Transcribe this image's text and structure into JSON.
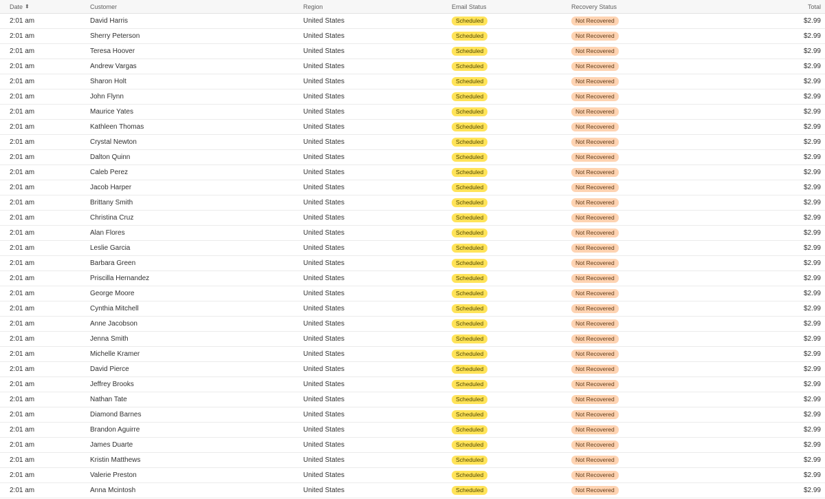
{
  "columns": {
    "date": "Date",
    "customer": "Customer",
    "region": "Region",
    "email_status": "Email Status",
    "recovery_status": "Recovery Status",
    "total": "Total"
  },
  "sort_icon": "sort-icon",
  "colors": {
    "email_badge_bg": "#ffe358",
    "recovery_badge_bg": "#fed3b2"
  },
  "rows": [
    {
      "date": "2:01 am",
      "customer": "David Harris",
      "region": "United States",
      "email_status": "Scheduled",
      "recovery_status": "Not Recovered",
      "total": "$2.99"
    },
    {
      "date": "2:01 am",
      "customer": "Sherry Peterson",
      "region": "United States",
      "email_status": "Scheduled",
      "recovery_status": "Not Recovered",
      "total": "$2.99"
    },
    {
      "date": "2:01 am",
      "customer": "Teresa Hoover",
      "region": "United States",
      "email_status": "Scheduled",
      "recovery_status": "Not Recovered",
      "total": "$2.99"
    },
    {
      "date": "2:01 am",
      "customer": "Andrew Vargas",
      "region": "United States",
      "email_status": "Scheduled",
      "recovery_status": "Not Recovered",
      "total": "$2.99"
    },
    {
      "date": "2:01 am",
      "customer": "Sharon Holt",
      "region": "United States",
      "email_status": "Scheduled",
      "recovery_status": "Not Recovered",
      "total": "$2.99"
    },
    {
      "date": "2:01 am",
      "customer": "John Flynn",
      "region": "United States",
      "email_status": "Scheduled",
      "recovery_status": "Not Recovered",
      "total": "$2.99"
    },
    {
      "date": "2:01 am",
      "customer": "Maurice Yates",
      "region": "United States",
      "email_status": "Scheduled",
      "recovery_status": "Not Recovered",
      "total": "$2.99"
    },
    {
      "date": "2:01 am",
      "customer": "Kathleen Thomas",
      "region": "United States",
      "email_status": "Scheduled",
      "recovery_status": "Not Recovered",
      "total": "$2.99"
    },
    {
      "date": "2:01 am",
      "customer": "Crystal Newton",
      "region": "United States",
      "email_status": "Scheduled",
      "recovery_status": "Not Recovered",
      "total": "$2.99"
    },
    {
      "date": "2:01 am",
      "customer": "Dalton Quinn",
      "region": "United States",
      "email_status": "Scheduled",
      "recovery_status": "Not Recovered",
      "total": "$2.99"
    },
    {
      "date": "2:01 am",
      "customer": "Caleb Perez",
      "region": "United States",
      "email_status": "Scheduled",
      "recovery_status": "Not Recovered",
      "total": "$2.99"
    },
    {
      "date": "2:01 am",
      "customer": "Jacob Harper",
      "region": "United States",
      "email_status": "Scheduled",
      "recovery_status": "Not Recovered",
      "total": "$2.99"
    },
    {
      "date": "2:01 am",
      "customer": "Brittany Smith",
      "region": "United States",
      "email_status": "Scheduled",
      "recovery_status": "Not Recovered",
      "total": "$2.99"
    },
    {
      "date": "2:01 am",
      "customer": "Christina Cruz",
      "region": "United States",
      "email_status": "Scheduled",
      "recovery_status": "Not Recovered",
      "total": "$2.99"
    },
    {
      "date": "2:01 am",
      "customer": "Alan Flores",
      "region": "United States",
      "email_status": "Scheduled",
      "recovery_status": "Not Recovered",
      "total": "$2.99"
    },
    {
      "date": "2:01 am",
      "customer": "Leslie Garcia",
      "region": "United States",
      "email_status": "Scheduled",
      "recovery_status": "Not Recovered",
      "total": "$2.99"
    },
    {
      "date": "2:01 am",
      "customer": "Barbara Green",
      "region": "United States",
      "email_status": "Scheduled",
      "recovery_status": "Not Recovered",
      "total": "$2.99"
    },
    {
      "date": "2:01 am",
      "customer": "Priscilla Hernandez",
      "region": "United States",
      "email_status": "Scheduled",
      "recovery_status": "Not Recovered",
      "total": "$2.99"
    },
    {
      "date": "2:01 am",
      "customer": "George Moore",
      "region": "United States",
      "email_status": "Scheduled",
      "recovery_status": "Not Recovered",
      "total": "$2.99"
    },
    {
      "date": "2:01 am",
      "customer": "Cynthia Mitchell",
      "region": "United States",
      "email_status": "Scheduled",
      "recovery_status": "Not Recovered",
      "total": "$2.99"
    },
    {
      "date": "2:01 am",
      "customer": "Anne Jacobson",
      "region": "United States",
      "email_status": "Scheduled",
      "recovery_status": "Not Recovered",
      "total": "$2.99"
    },
    {
      "date": "2:01 am",
      "customer": "Jenna Smith",
      "region": "United States",
      "email_status": "Scheduled",
      "recovery_status": "Not Recovered",
      "total": "$2.99"
    },
    {
      "date": "2:01 am",
      "customer": "Michelle Kramer",
      "region": "United States",
      "email_status": "Scheduled",
      "recovery_status": "Not Recovered",
      "total": "$2.99"
    },
    {
      "date": "2:01 am",
      "customer": "David Pierce",
      "region": "United States",
      "email_status": "Scheduled",
      "recovery_status": "Not Recovered",
      "total": "$2.99"
    },
    {
      "date": "2:01 am",
      "customer": "Jeffrey Brooks",
      "region": "United States",
      "email_status": "Scheduled",
      "recovery_status": "Not Recovered",
      "total": "$2.99"
    },
    {
      "date": "2:01 am",
      "customer": "Nathan Tate",
      "region": "United States",
      "email_status": "Scheduled",
      "recovery_status": "Not Recovered",
      "total": "$2.99"
    },
    {
      "date": "2:01 am",
      "customer": "Diamond Barnes",
      "region": "United States",
      "email_status": "Scheduled",
      "recovery_status": "Not Recovered",
      "total": "$2.99"
    },
    {
      "date": "2:01 am",
      "customer": "Brandon Aguirre",
      "region": "United States",
      "email_status": "Scheduled",
      "recovery_status": "Not Recovered",
      "total": "$2.99"
    },
    {
      "date": "2:01 am",
      "customer": "James Duarte",
      "region": "United States",
      "email_status": "Scheduled",
      "recovery_status": "Not Recovered",
      "total": "$2.99"
    },
    {
      "date": "2:01 am",
      "customer": "Kristin Matthews",
      "region": "United States",
      "email_status": "Scheduled",
      "recovery_status": "Not Recovered",
      "total": "$2.99"
    },
    {
      "date": "2:01 am",
      "customer": "Valerie Preston",
      "region": "United States",
      "email_status": "Scheduled",
      "recovery_status": "Not Recovered",
      "total": "$2.99"
    },
    {
      "date": "2:01 am",
      "customer": "Anna Mcintosh",
      "region": "United States",
      "email_status": "Scheduled",
      "recovery_status": "Not Recovered",
      "total": "$2.99"
    }
  ]
}
